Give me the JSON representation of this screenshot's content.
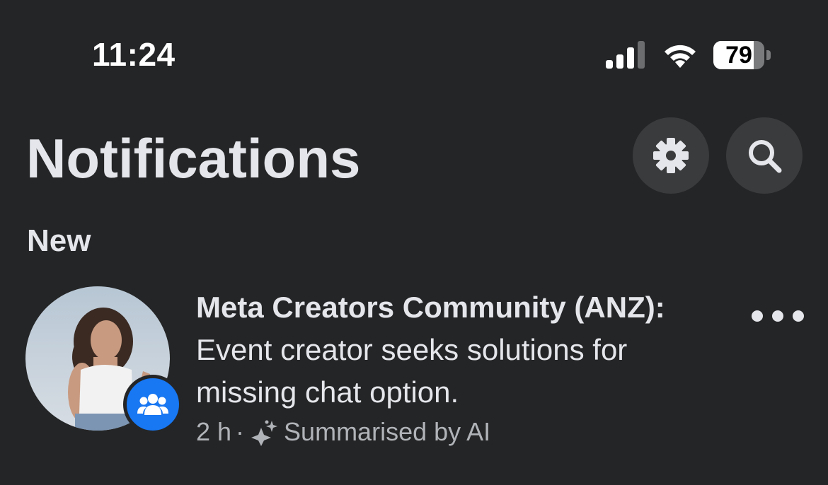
{
  "status_bar": {
    "time": "11:24",
    "battery_level": "79",
    "battery_fraction": 0.79,
    "icons": [
      "signal-icon",
      "wifi-icon",
      "battery-icon"
    ]
  },
  "header": {
    "title": "Notifications",
    "actions": [
      "gear-icon",
      "search-icon"
    ]
  },
  "section": {
    "label": "New"
  },
  "notifications": [
    {
      "source": "Meta Creators Community (ANZ):",
      "message": "Event creator seeks solutions for missing chat option.",
      "time": "2 h",
      "separator": "·",
      "summary": "Summarised by AI",
      "badge_icon": "group-icon",
      "summary_icon": "ai-sparkle-icon",
      "more_icon": "more-dots-icon"
    }
  ],
  "colors": {
    "background": "#242526",
    "text_primary": "#e4e6eb",
    "text_secondary": "#b0b3b8",
    "button_bg": "#3a3b3c",
    "accent_blue": "#1877f2"
  }
}
